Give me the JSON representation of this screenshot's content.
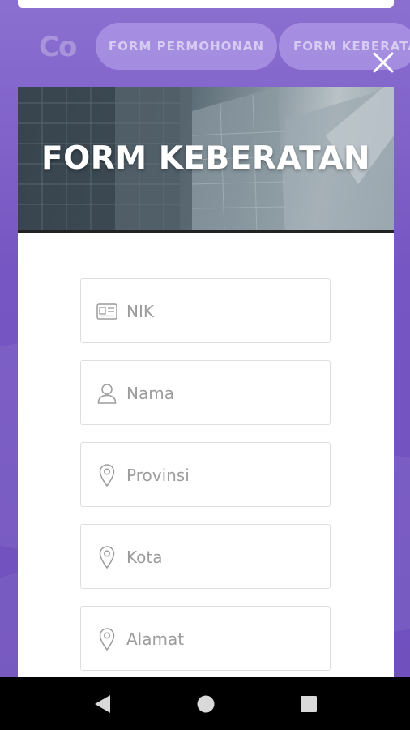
{
  "header": {
    "logo_text": "Co",
    "tabs": [
      {
        "label": "FORM PERMOHONAN"
      },
      {
        "label": "FORM KEBERATAN"
      }
    ]
  },
  "modal": {
    "title": "FORM KEBERATAN",
    "fields": [
      {
        "placeholder": "NIK",
        "icon": "id-card-icon"
      },
      {
        "placeholder": "Nama",
        "icon": "user-icon"
      },
      {
        "placeholder": "Provinsi",
        "icon": "map-pin-icon"
      },
      {
        "placeholder": "Kota",
        "icon": "map-pin-icon"
      },
      {
        "placeholder": "Alamat",
        "icon": "map-pin-icon"
      }
    ]
  },
  "colors": {
    "background": "#7a5cc4",
    "pill": "#beaaf0",
    "navbar": "#000000"
  },
  "navbar": {
    "buttons": [
      "back-icon",
      "home-icon",
      "recents-icon"
    ]
  }
}
